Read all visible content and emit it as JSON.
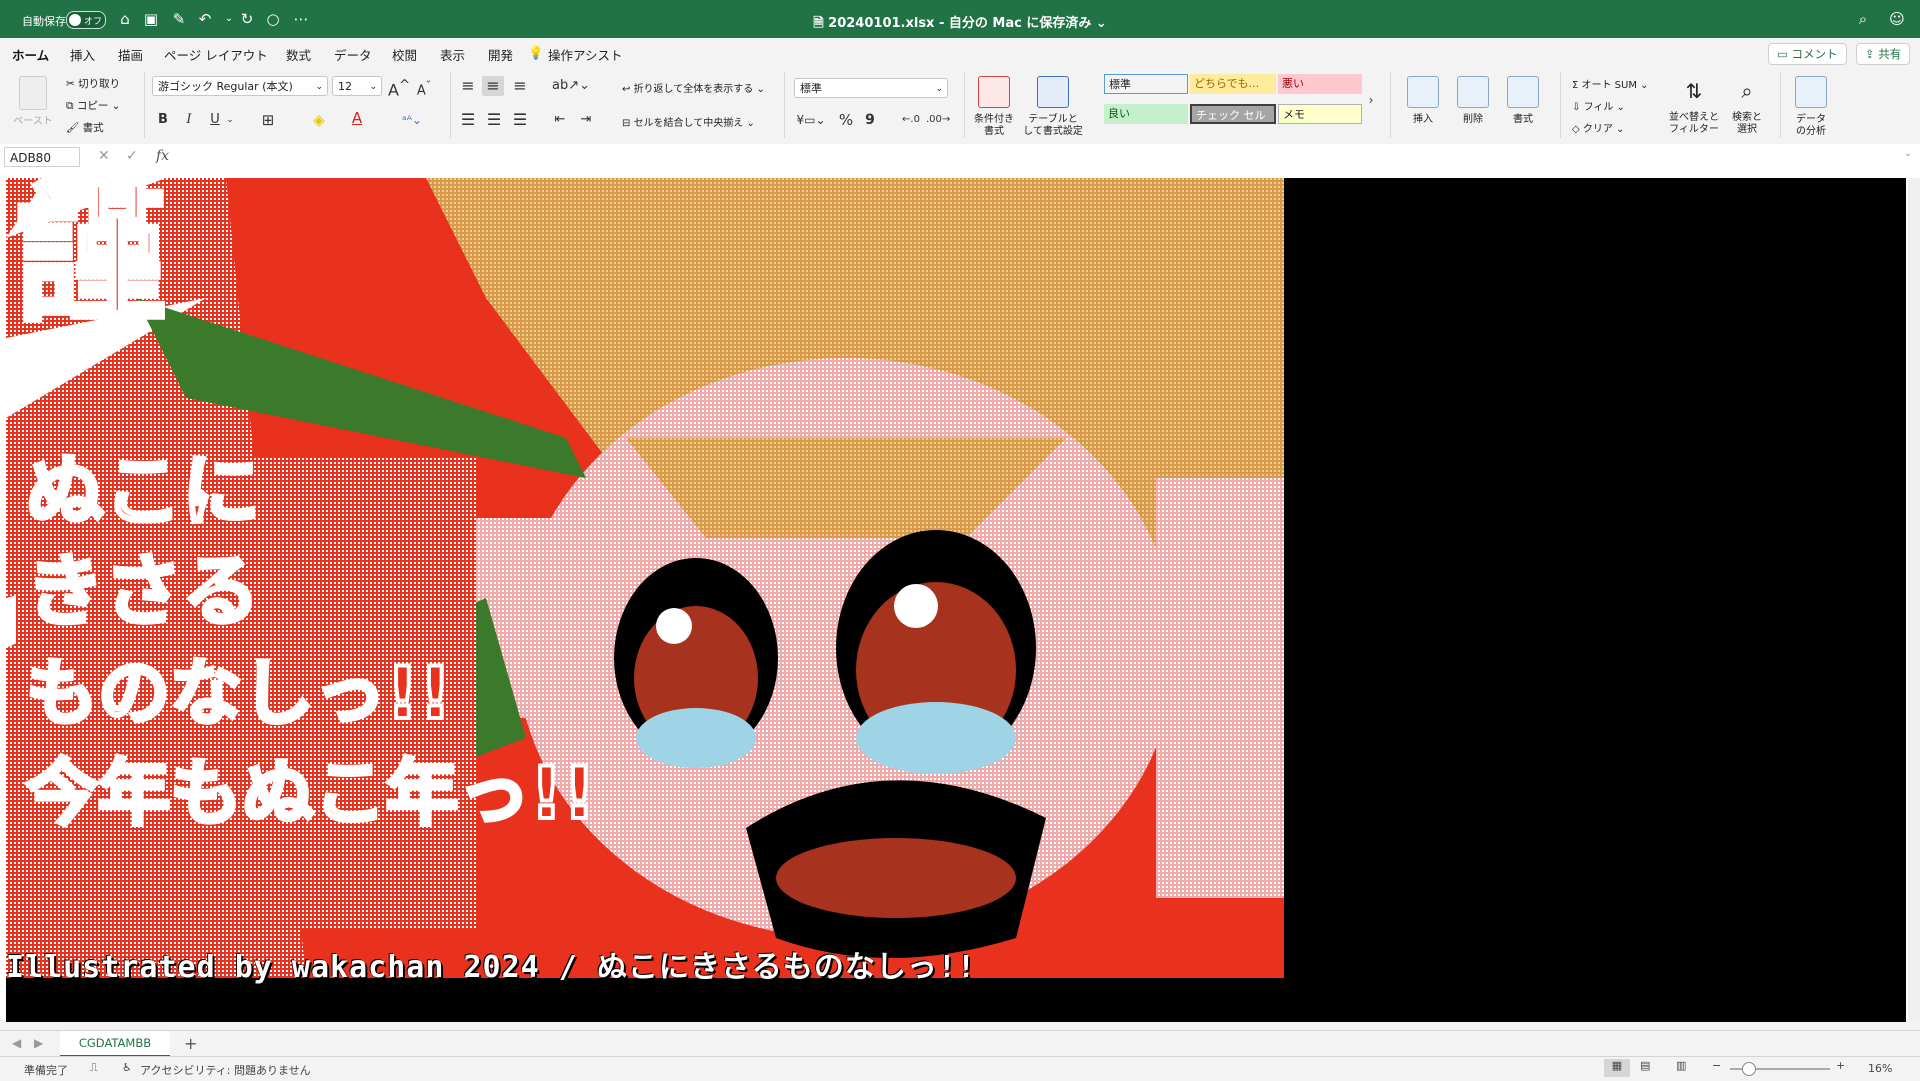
{
  "titlebar": {
    "autosave_label": "自動保存",
    "autosave_state": "オフ",
    "title": "20240101.xlsx - 自分の Mac に保存済み",
    "title_suffix": "⌄"
  },
  "tabs": [
    "ホーム",
    "挿入",
    "描画",
    "ページ レイアウト",
    "数式",
    "データ",
    "校閲",
    "表示",
    "開発"
  ],
  "assist": "操作アシスト",
  "comment_button": "コメント",
  "share_button": "共有",
  "clipboard": {
    "paste": "ペースト",
    "cut": "切り取り",
    "copy": "コピー",
    "format": "書式"
  },
  "font": {
    "name": "游ゴシック Regular (本文)",
    "size": "12",
    "bold": "B",
    "italic": "I",
    "underline": "U"
  },
  "alignment": {
    "wrap": "折り返して全体を表示する",
    "merge": "セルを結合して中央揃え"
  },
  "number": {
    "format": "標準",
    "percent": "%",
    "comma": "9"
  },
  "styles": {
    "conditional": "条件付き\n書式",
    "table": "テーブルとして書式設定",
    "cells": [
      {
        "label": "標準",
        "bg": "#ffffff",
        "fg": "#222222"
      },
      {
        "label": "どちらでも...",
        "bg": "#ffeb9c",
        "fg": "#9c6500"
      },
      {
        "label": "悪い",
        "bg": "#ffc7ce",
        "fg": "#9c0006"
      },
      {
        "label": "良い",
        "bg": "#c6efce",
        "fg": "#006100"
      },
      {
        "label": "チェック セル",
        "bg": "#a5a5a5",
        "fg": "#ffffff"
      },
      {
        "label": "メモ",
        "bg": "#ffffcc",
        "fg": "#222222"
      }
    ]
  },
  "cells_group": {
    "insert": "挿入",
    "delete": "削除",
    "format": "書式"
  },
  "editing": {
    "autosum": "オート SUM",
    "fill": "フィル",
    "clear": "クリア",
    "sort": "並べ替えと\nフィルター",
    "find": "検索と\n選択",
    "analyze": "データ\nの分析"
  },
  "formula": {
    "namebox": "ADB80",
    "fx": "fx",
    "value": ""
  },
  "image_caption": "Illustrated by wakachan 2024 / ぬこにきさるものなしっ!!",
  "sheet_tab": "CGDATAMBB",
  "status": {
    "ready": "準備完了",
    "accessibility": "アクセシビリティ: 問題ありません",
    "zoom": "16%"
  },
  "colors": {
    "excel_green": "#217346",
    "art_red": "#e8321e",
    "art_orange": "#d89a4a",
    "art_black": "#000000"
  }
}
